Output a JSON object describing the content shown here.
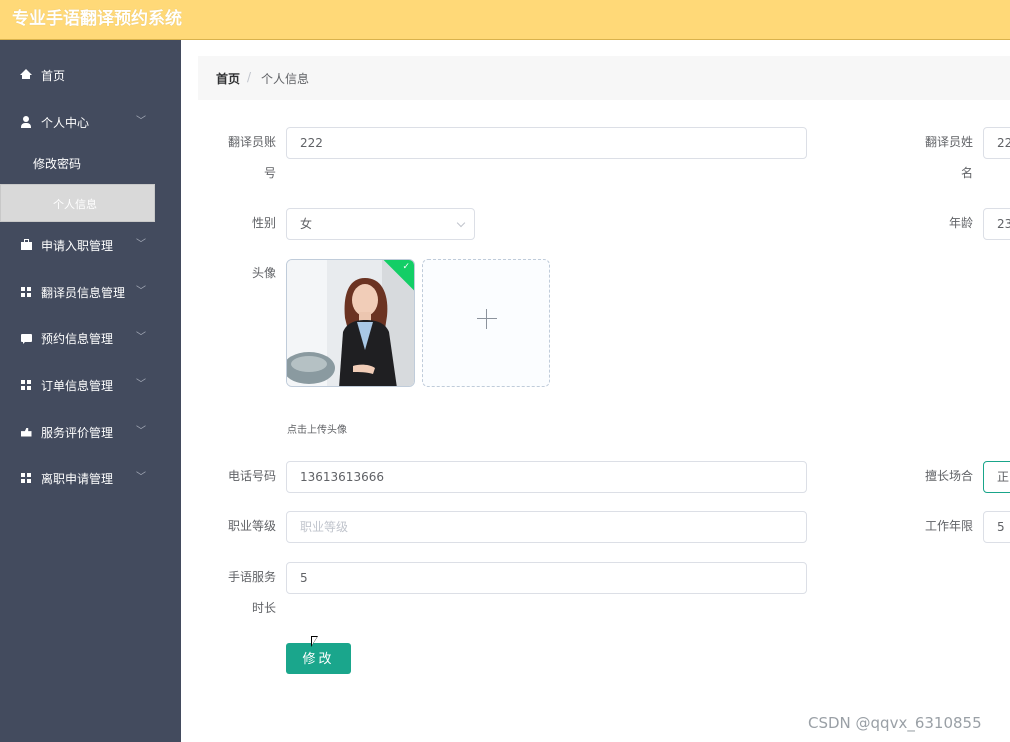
{
  "header": {
    "title": "专业手语翻译预约系统"
  },
  "sidebar": {
    "items": [
      {
        "label": "首页",
        "icon": "home-icon"
      },
      {
        "label": "个人中心",
        "icon": "user-icon"
      },
      {
        "label": "申请入职管理",
        "icon": "briefcase-icon"
      },
      {
        "label": "翻译员信息管理",
        "icon": "grid-icon"
      },
      {
        "label": "预约信息管理",
        "icon": "chat-icon"
      },
      {
        "label": "订单信息管理",
        "icon": "grid-icon"
      },
      {
        "label": "服务评价管理",
        "icon": "thumbs-up-icon"
      },
      {
        "label": "离职申请管理",
        "icon": "grid-icon"
      }
    ],
    "sub_items": [
      {
        "label": "修改密码"
      },
      {
        "label": "个人信息"
      }
    ]
  },
  "breadcrumb": {
    "home": "首页",
    "separator": "/",
    "current": "个人信息"
  },
  "form": {
    "account_label_1": "翻译员账",
    "account_label_2": "号",
    "account_value": "222",
    "name_label_1": "翻译员姓",
    "name_label_2": "名",
    "name_value": "22",
    "gender_label": "性别",
    "gender_value": "女",
    "age_label": "年龄",
    "age_value": "23",
    "avatar_label": "头像",
    "upload_tip": "点击上传头像",
    "phone_label": "电话号码",
    "phone_value": "13613613666",
    "specialty_label": "擅长场合",
    "specialty_value": "正",
    "level_label": "职业等级",
    "level_placeholder": "职业等级",
    "years_label": "工作年限",
    "years_value": "5",
    "duration_label_1": "手语服务",
    "duration_label_2": "时长",
    "duration_value": "5",
    "submit_label": "修改"
  },
  "watermark": "CSDN @qqvx_6310855",
  "colors": {
    "header": "#ffd978",
    "sidebar": "#434b5e",
    "primary": "#1aa68c"
  }
}
